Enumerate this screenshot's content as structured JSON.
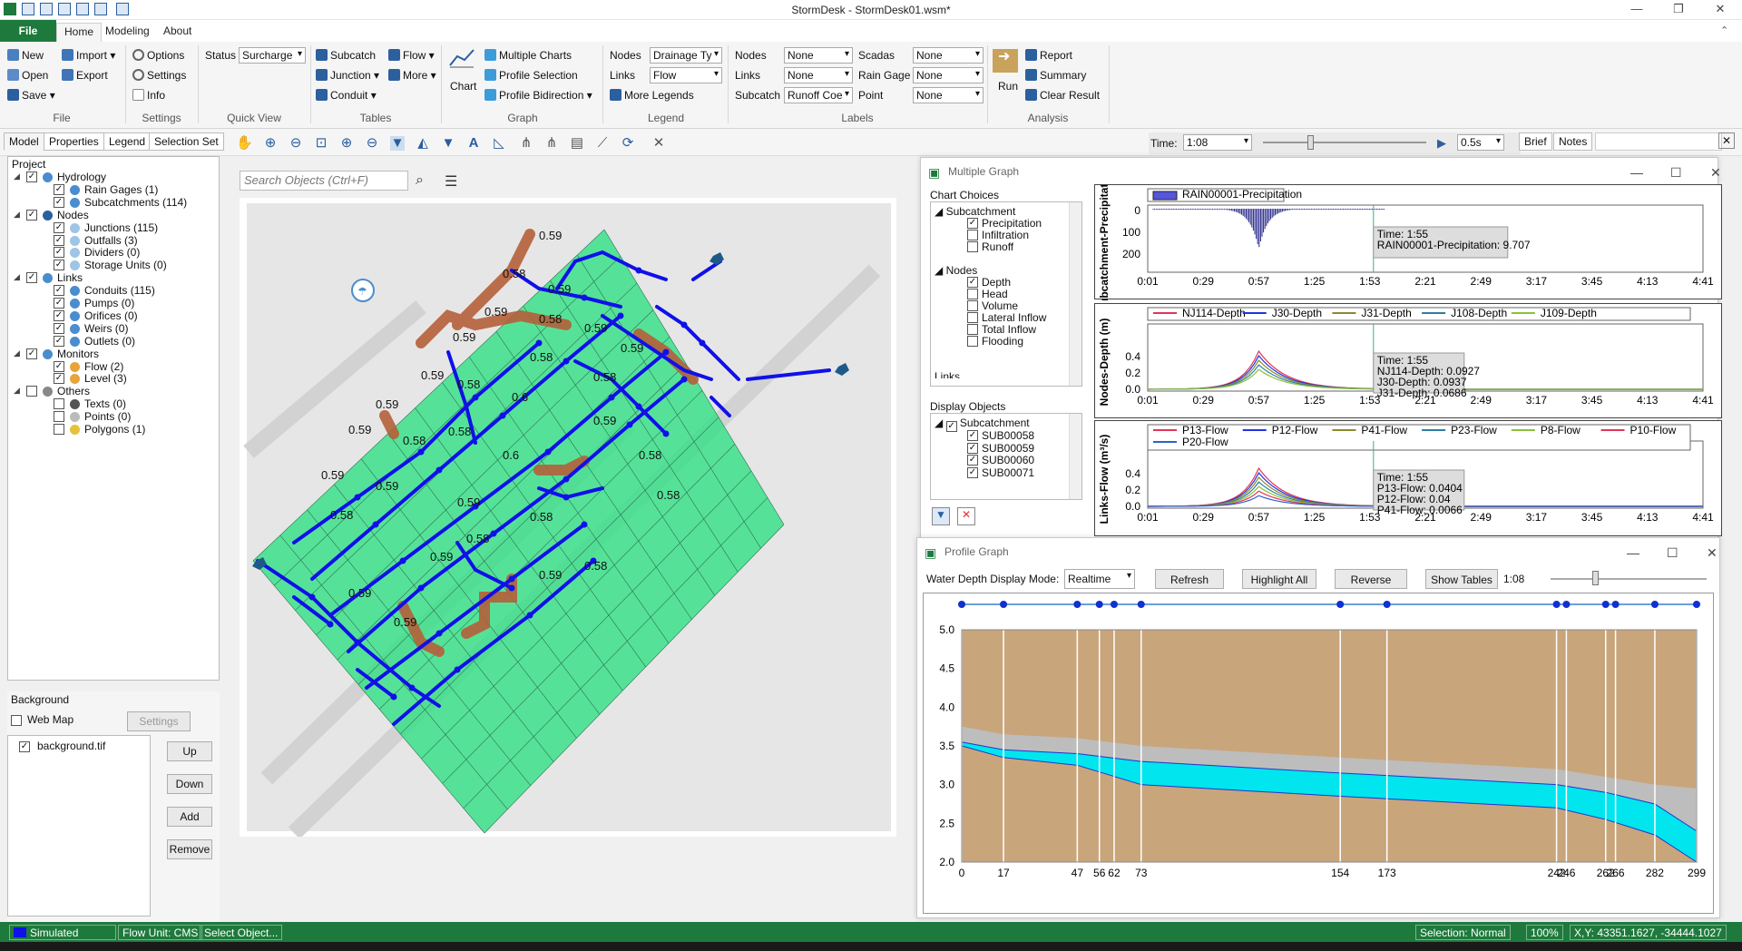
{
  "app": {
    "title": "StormDesk - StormDesk01.wsm*"
  },
  "menu": {
    "file": "File",
    "home": "Home",
    "modeling": "Modeling",
    "about": "About"
  },
  "ribbon": {
    "file": {
      "new": "New",
      "open": "Open",
      "save": "Save",
      "import": "Import",
      "export": "Export",
      "group": "File"
    },
    "settings": {
      "options": "Options",
      "settings": "Settings",
      "info": "Info",
      "group": "Settings"
    },
    "quickview": {
      "status_label": "Status",
      "status_value": "Surcharge",
      "group": "Quick View"
    },
    "tables": {
      "subcatch": "Subcatch",
      "junction": "Junction",
      "conduit": "Conduit",
      "flow": "Flow",
      "more": "More",
      "group": "Tables"
    },
    "graph": {
      "chart": "Chart",
      "multiple_charts": "Multiple Charts",
      "profile_selection": "Profile Selection",
      "profile_bidirection": "Profile Bidirection",
      "group": "Graph"
    },
    "legend": {
      "nodes_label": "Nodes",
      "nodes_value": "Drainage Ty",
      "links_label": "Links",
      "links_value": "Flow",
      "more_legends": "More Legends",
      "group": "Legend"
    },
    "labels": {
      "nodes_label": "Nodes",
      "nodes_value": "None",
      "links_label": "Links",
      "links_value": "None",
      "subcatch_label": "Subcatch",
      "subcatch_value": "Runoff Coe",
      "scadas_label": "Scadas",
      "scadas_value": "None",
      "raingage_label": "Rain Gage",
      "raingage_value": "None",
      "point_label": "Point",
      "point_value": "None",
      "group": "Labels"
    },
    "analysis": {
      "run": "Run",
      "report": "Report",
      "summary": "Summary",
      "clear_result": "Clear Result",
      "group": "Analysis"
    }
  },
  "panel_tabs": [
    "Model",
    "Properties",
    "Legend",
    "Selection Set"
  ],
  "time": {
    "label": "Time:",
    "value": "1:08",
    "speed": "0.5s",
    "progress": 0.27
  },
  "right_tabs": {
    "brief": "Brief",
    "notes": "Notes"
  },
  "tree": {
    "project": "Project",
    "items": [
      {
        "label": "Hydrology",
        "checked": true,
        "expanded": true
      },
      {
        "label": "Rain Gages (1)",
        "checked": true
      },
      {
        "label": "Subcatchments (114)",
        "checked": true
      },
      {
        "label": "Nodes",
        "checked": true,
        "expanded": true
      },
      {
        "label": "Junctions (115)",
        "checked": true
      },
      {
        "label": "Outfalls (3)",
        "checked": true
      },
      {
        "label": "Dividers (0)",
        "checked": true
      },
      {
        "label": "Storage Units (0)",
        "checked": true
      },
      {
        "label": "Links",
        "checked": true,
        "expanded": true
      },
      {
        "label": "Conduits (115)",
        "checked": true
      },
      {
        "label": "Pumps (0)",
        "checked": true
      },
      {
        "label": "Orifices (0)",
        "checked": true
      },
      {
        "label": "Weirs (0)",
        "checked": true
      },
      {
        "label": "Outlets (0)",
        "checked": true
      },
      {
        "label": "Monitors",
        "checked": true,
        "expanded": true
      },
      {
        "label": "Flow (2)",
        "checked": true
      },
      {
        "label": "Level (3)",
        "checked": true
      },
      {
        "label": "Others",
        "checked": false,
        "expanded": true
      },
      {
        "label": "Texts (0)",
        "checked": false
      },
      {
        "label": "Points (0)",
        "checked": false
      },
      {
        "label": "Polygons (1)",
        "checked": false
      }
    ]
  },
  "background": {
    "title": "Background",
    "web_map": "Web Map",
    "settings": "Settings",
    "file": "background.tif",
    "up": "Up",
    "down": "Down",
    "add": "Add",
    "remove": "Remove"
  },
  "search": {
    "placeholder": "Search Objects (Ctrl+F)"
  },
  "map_labels": [
    "0.59",
    "0.58",
    "0.59",
    "0.59",
    "0.58",
    "0.59",
    "0.59",
    "0.58",
    "0.59",
    "0.59",
    "0.58",
    "0.58",
    "0.59",
    "0.6",
    "0.59",
    "0.58",
    "0.59",
    "0.58",
    "0.58",
    "0.59",
    "0.6",
    "0.59",
    "0.58",
    "0.58",
    "0.59",
    "0.58",
    "0.58",
    "0.59",
    "0.59",
    "0.58",
    "0.59",
    "0.59"
  ],
  "multiple_graph": {
    "title": "Multiple Graph",
    "chart_choices": "Chart Choices",
    "subcatchment": "Subcatchment",
    "sub_choices": [
      {
        "label": "Precipitation",
        "checked": true
      },
      {
        "label": "Infiltration",
        "checked": false
      },
      {
        "label": "Runoff",
        "checked": false
      }
    ],
    "nodes": "Nodes",
    "node_choices": [
      {
        "label": "Depth",
        "checked": true
      },
      {
        "label": "Head",
        "checked": false
      },
      {
        "label": "Volume",
        "checked": false
      },
      {
        "label": "Lateral Inflow",
        "checked": false
      },
      {
        "label": "Total Inflow",
        "checked": false
      },
      {
        "label": "Flooding",
        "checked": false
      }
    ],
    "links_cut": "Links",
    "display_objects": "Display Objects",
    "obj_subcatchment": "Subcatchment",
    "objects": [
      "SUB00058",
      "SUB00059",
      "SUB00060",
      "SUB00071"
    ]
  },
  "chart_data": [
    {
      "type": "bar",
      "ylabel": "Subcatchment-Precipitatio",
      "legend": [
        "RAIN00001-Precipitation"
      ],
      "y_ticks": [
        "0",
        "100",
        "200"
      ],
      "x_ticks": [
        "0:01",
        "0:29",
        "0:57",
        "1:25",
        "1:53",
        "2:21",
        "2:49",
        "3:17",
        "3:45",
        "4:13",
        "4:41"
      ],
      "tooltip": [
        "Time: 1:55",
        "RAIN00001-Precipitation: 9.707"
      ],
      "peak": {
        "x": "0:57",
        "y": 160
      }
    },
    {
      "type": "line",
      "ylabel": "Nodes-Depth (m)",
      "legend": [
        "NJ114-Depth",
        "J30-Depth",
        "J31-Depth",
        "J108-Depth",
        "J109-Depth"
      ],
      "y_ticks": [
        "0.0",
        "0.2",
        "0.4"
      ],
      "x_ticks": [
        "0:01",
        "0:29",
        "0:57",
        "1:25",
        "1:53",
        "2:21",
        "2:49",
        "3:17",
        "3:45",
        "4:13",
        "4:41"
      ],
      "tooltip": [
        "Time: 1:55",
        "NJ114-Depth: 0.0927",
        "J30-Depth: 0.0937",
        "J31-Depth: 0.0686"
      ],
      "peak": {
        "x": "0:57",
        "y": 0.28
      }
    },
    {
      "type": "line",
      "ylabel": "Links-Flow (m³/s)",
      "legend": [
        "P13-Flow",
        "P12-Flow",
        "P41-Flow",
        "P23-Flow",
        "P8-Flow",
        "P10-Flow",
        "P20-Flow"
      ],
      "y_ticks": [
        "0.0",
        "0.2",
        "0.4"
      ],
      "x_ticks": [
        "0:01",
        "0:29",
        "0:57",
        "1:25",
        "1:53",
        "2:21",
        "2:49",
        "3:17",
        "3:45",
        "4:13",
        "4:41"
      ],
      "tooltip": [
        "Time: 1:55",
        "P13-Flow: 0.0404",
        "P12-Flow: 0.04",
        "P41-Flow: 0.0066"
      ],
      "peak": {
        "x": "0:57",
        "y": 0.27
      }
    },
    {
      "type": "area",
      "title": "Profile Graph",
      "y_ticks": [
        "2.0",
        "2.5",
        "3.0",
        "3.5",
        "4.0",
        "4.5",
        "5.0"
      ],
      "x_ticks": [
        "0",
        "17",
        "47",
        "56",
        "62",
        "73",
        "154",
        "173",
        "242",
        "246",
        "262",
        "266",
        "282",
        "299"
      ],
      "ylim": [
        2.0,
        5.0
      ],
      "xlim": [
        0,
        299
      ]
    }
  ],
  "profile": {
    "title": "Profile Graph",
    "mode_label": "Water Depth Display Mode:",
    "mode_value": "Realtime",
    "refresh": "Refresh",
    "highlight": "Highlight All",
    "reverse": "Reverse",
    "show_tables": "Show Tables",
    "time": "1:08"
  },
  "status": {
    "simulated": "Simulated",
    "flow_unit": "Flow Unit: CMS",
    "select": "Select Object...",
    "selection": "Selection: Normal",
    "zoom": "100%",
    "coords": "X,Y: 43351.1627, -34444.1027"
  },
  "colors": {
    "accent": "#1e7a3c",
    "subcatch": "#3be08a",
    "conduit": "#1010e8",
    "highlight": "#b5603a",
    "water": "#00e5ee",
    "ground": "#c9a57c"
  }
}
